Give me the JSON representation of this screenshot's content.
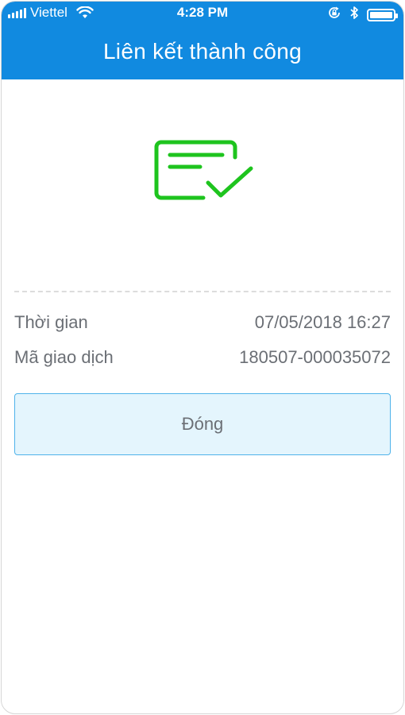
{
  "status_bar": {
    "carrier": "Viettel",
    "time": "4:28 PM"
  },
  "header": {
    "title": "Liên kết thành công",
    "background_color": "#118ae0"
  },
  "hero": {
    "icon": "card-check-icon",
    "icon_color": "#1ec41e"
  },
  "details": [
    {
      "label": "Thời gian",
      "value": "07/05/2018 16:27"
    },
    {
      "label": "Mã giao dịch",
      "value": "180507-000035072"
    }
  ],
  "actions": {
    "close_label": "Đóng"
  }
}
